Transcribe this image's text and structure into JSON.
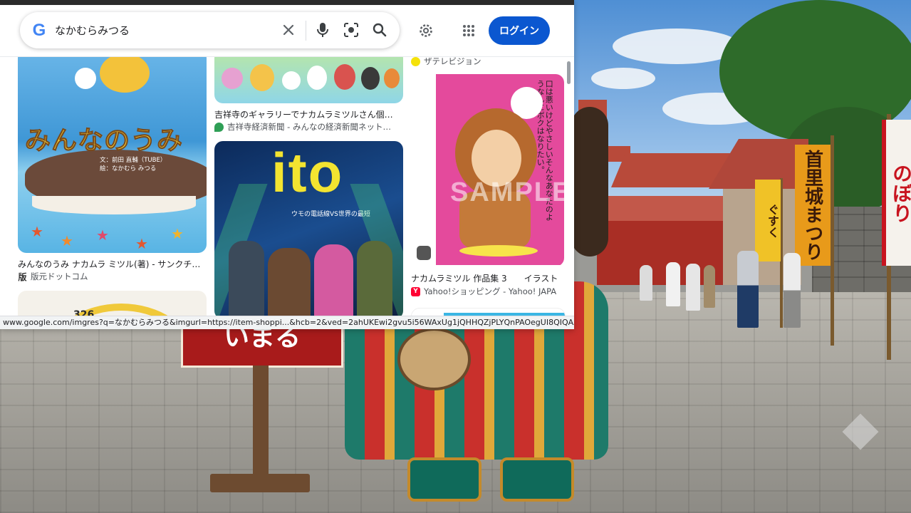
{
  "search": {
    "query": "なかむらみつる",
    "login_label": "ログイン"
  },
  "results": [
    {
      "title": "みんなのうみ ナカムラ ミツル(著) - サンクチ…",
      "source": "版元ドットコム",
      "art_title": "みんなのうみ",
      "art_credits": "文：前田 直輔（TUBE）\n絵：なかむら みつる"
    },
    {
      "title": "吉祥寺のギャラリーでナカムラミツルさん個…",
      "source": "吉祥寺経済新聞 - みんなの経済新聞ネット…"
    },
    {
      "title": "",
      "source": "",
      "art_title": "ito",
      "art_subtitle": "ウモの電話線VS世界の最短"
    },
    {
      "title": "",
      "source": "ザテレビジョン"
    },
    {
      "title": "ナカムラミツル 作品集 3　　イラスト",
      "source": "Yahoo!ショッピング - Yahoo! JAPA",
      "art_text": "口は悪いけどやさしいそんなあなたのようなんにボクはなりたい。",
      "watermark": "SAMPLE"
    }
  ],
  "status_url": "www.google.com/imgres?q=なかむらみつる&imgurl=https://item-shoppi...&hcb=2&ved=2ahUKEwi2gvu5i56WAxUg1jQHHQZjPLYQnPAOegUI8QIQAA",
  "background": {
    "sign_text": "いまる",
    "banners": [
      "首里城まつり",
      "のぼり",
      "ぐすく"
    ]
  },
  "colors": {
    "accent": "#0b57d0",
    "google_blue": "#4285f4",
    "banner_orange": "#e89a1a",
    "banner_red": "#c8141f"
  },
  "icons": [
    "google-logo-icon",
    "clear-icon",
    "microphone-icon",
    "lens-icon",
    "search-icon",
    "settings-icon",
    "apps-grid-icon"
  ]
}
